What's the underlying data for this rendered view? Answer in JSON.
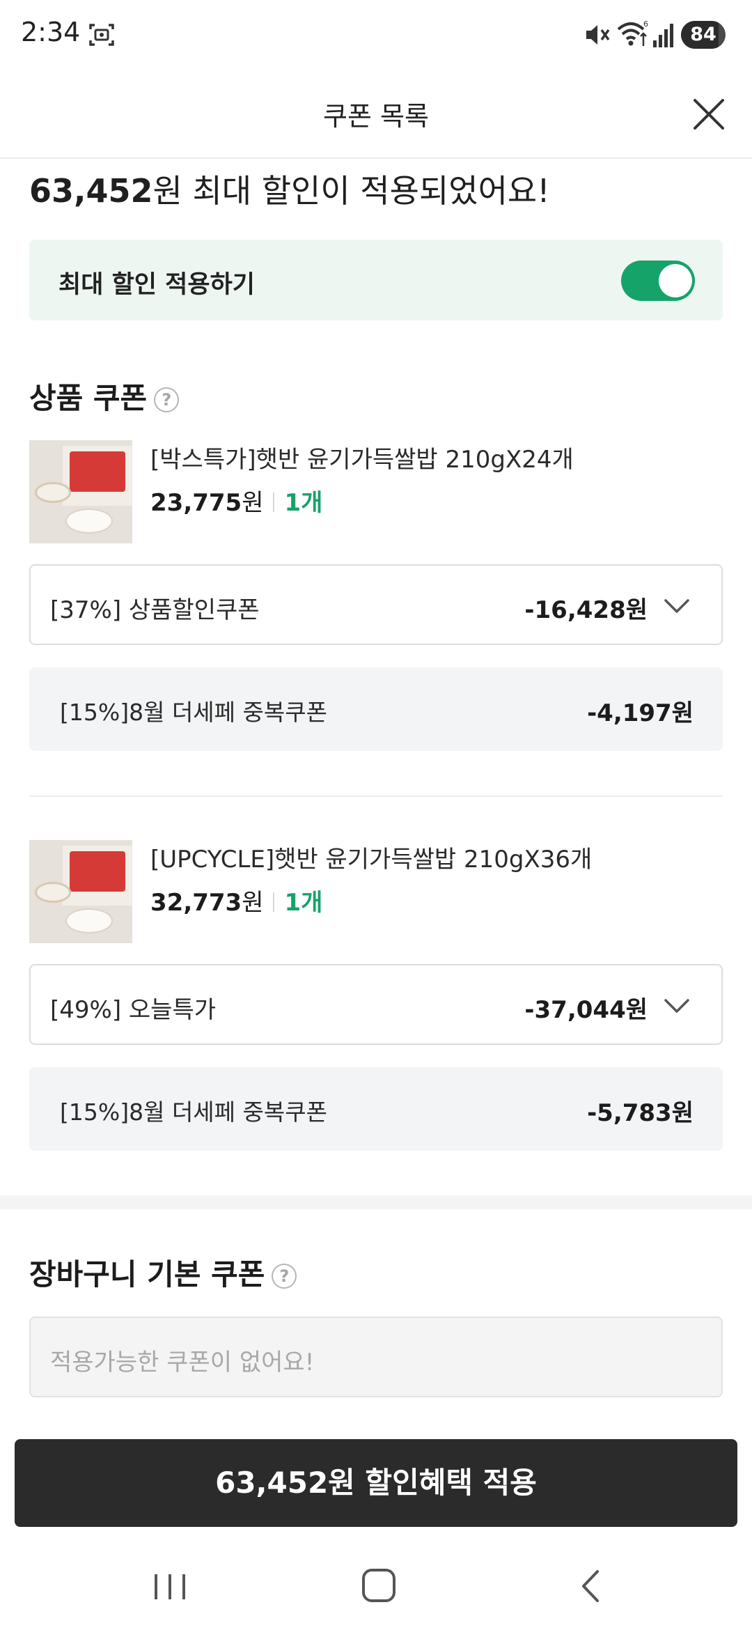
{
  "status_bar": {
    "time": "2:34",
    "battery": "84",
    "battery_level": 0.84,
    "icons": [
      "screenshot-icon",
      "mute-icon",
      "wifi-icon",
      "signal-icon",
      "battery-icon"
    ]
  },
  "header": {
    "title": "쿠폰 목록",
    "close_icon": "close-icon"
  },
  "summary": {
    "amount": "63,452",
    "text": "원 최대 할인이 적용되었어요!"
  },
  "max_discount": {
    "label": "최대 할인 적용하기",
    "enabled": true,
    "accent_color": "#16a36a"
  },
  "product_coupons": {
    "title": "상품 쿠폰",
    "help_icon": "?",
    "items": [
      {
        "name": "[박스특가]햇반 윤기가득쌀밥 210gX24개",
        "price": "23,775",
        "price_unit": "원",
        "qty": "1개",
        "coupon": {
          "label": "[37%] 상품할인쿠폰",
          "amount": "-16,428원"
        },
        "extra": {
          "label": "[15%]8월 더세페 중복쿠폰",
          "amount": "-4,197원"
        }
      },
      {
        "name": "[UPCYCLE]햇반 윤기가득쌀밥 210gX36개",
        "price": "32,773",
        "price_unit": "원",
        "qty": "1개",
        "coupon": {
          "label": "[49%] 오늘특가",
          "amount": "-37,044원"
        },
        "extra": {
          "label": "[15%]8월 더세페 중복쿠폰",
          "amount": "-5,783원"
        }
      }
    ]
  },
  "cart_coupons": {
    "title": "장바구니 기본 쿠폰",
    "help_icon": "?",
    "placeholder": "적용가능한 쿠폰이 없어요!"
  },
  "apply_button": {
    "label": "63,452원 할인혜택 적용"
  },
  "nav": {
    "icons": [
      "recent-apps-icon",
      "home-icon",
      "back-icon"
    ]
  }
}
